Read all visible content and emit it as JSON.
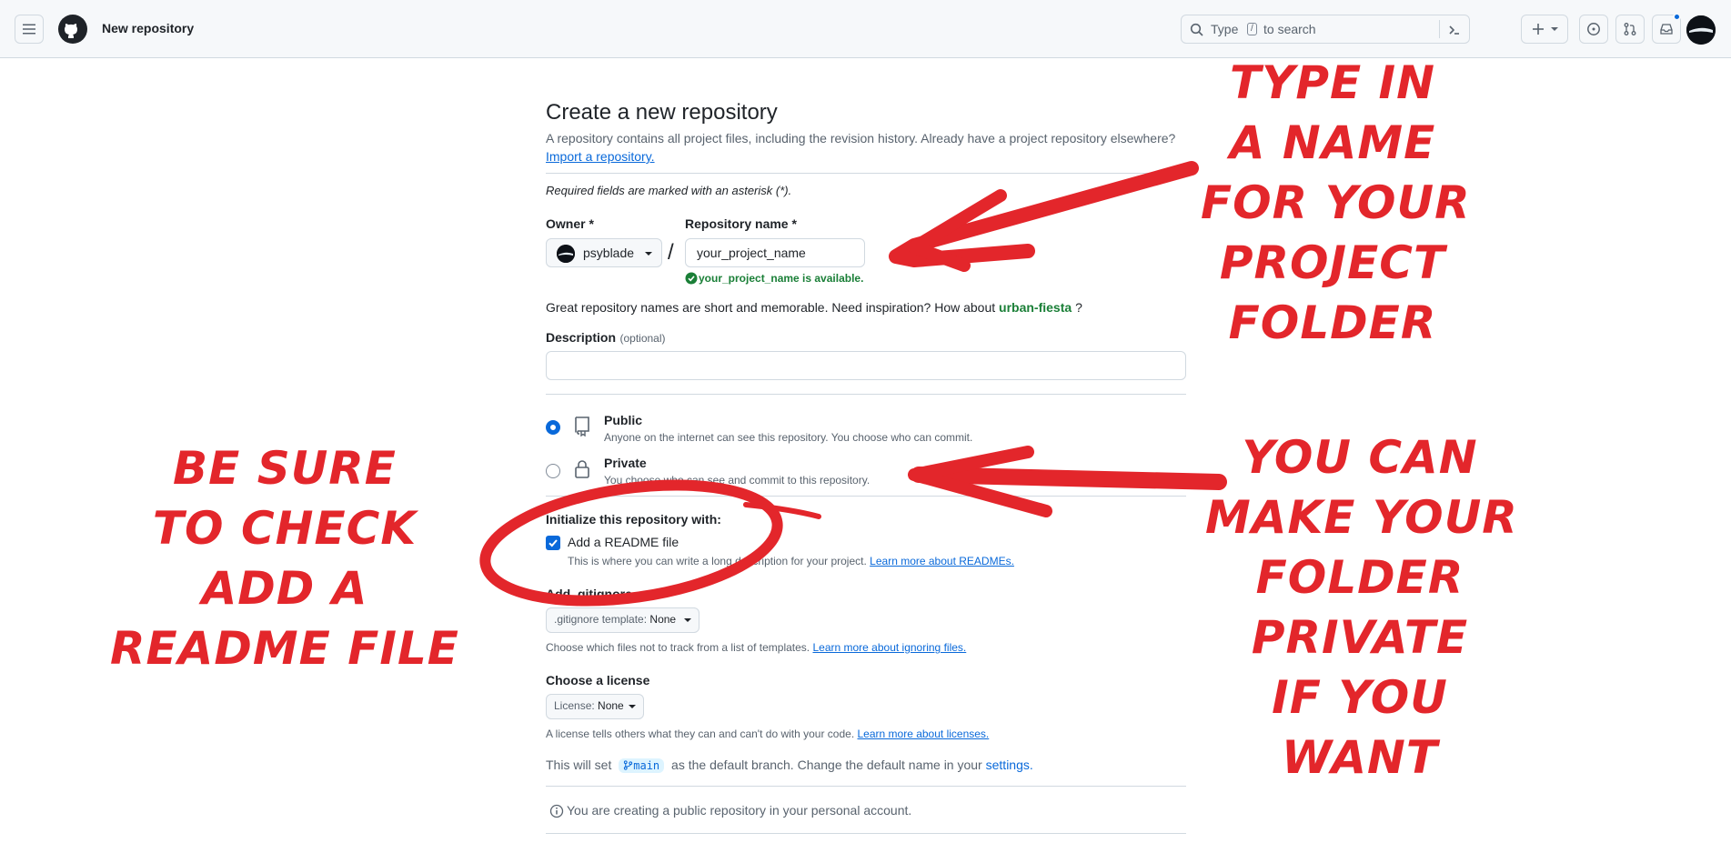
{
  "header": {
    "title": "New repository",
    "search": {
      "prefix": "Type",
      "key": "/",
      "suffix": "to search"
    }
  },
  "form": {
    "heading": "Create a new repository",
    "subtitle": "A repository contains all project files, including the revision history. Already have a project repository elsewhere?",
    "import_link": "Import a repository.",
    "required_note": "Required fields are marked with an asterisk (*).",
    "owner_label": "Owner *",
    "owner_value": "psyblade",
    "slash": "/",
    "repo_label": "Repository name *",
    "repo_value": "your_project_name",
    "availability": "your_project_name is available.",
    "inspiration_text": "Great repository names are short and memorable. Need inspiration? How about",
    "inspiration_name": "urban-fiesta",
    "inspiration_end": "?",
    "description_label": "Description",
    "description_optional": "(optional)",
    "description_value": "",
    "visibility": {
      "selected": "public",
      "public_title": "Public",
      "public_desc": "Anyone on the internet can see this repository. You choose who can commit.",
      "private_title": "Private",
      "private_desc": "You choose who can see and commit to this repository."
    },
    "init_label": "Initialize this repository with:",
    "readme_label": "Add a README file",
    "readme_checked": true,
    "readme_desc": "This is where you can write a long description for your project.",
    "readme_link": "Learn more about READMEs.",
    "gitignore_label": "Add .gitignore",
    "gitignore_select_prefix": ".gitignore template:",
    "gitignore_select_value": "None",
    "gitignore_desc": "Choose which files not to track from a list of templates.",
    "gitignore_link": "Learn more about ignoring files.",
    "license_label": "Choose a license",
    "license_select_prefix": "License:",
    "license_select_value": "None",
    "license_desc": "A license tells others what they can and can't do with your code.",
    "license_link": "Learn more about licenses.",
    "branch_pre": "This will set",
    "branch_name": "main",
    "branch_post": "as the default branch. Change the default name in your",
    "branch_link": "settings.",
    "info_note": "You are creating a public repository in your personal account."
  },
  "annotations": {
    "name": [
      "TYPE IN",
      "A NAME",
      "FOR YOUR",
      "PROJECT",
      "FOLDER"
    ],
    "readme": [
      "BE SURE",
      "TO CHECK",
      "ADD A",
      "README FILE"
    ],
    "private": [
      "YOU CAN",
      "MAKE YOUR",
      "FOLDER",
      "PRIVATE",
      "IF YOU",
      "WANT"
    ],
    "color": "#e3262b"
  },
  "colors": {
    "accent": "#0969da",
    "success": "#1a7f37",
    "header_bg": "#f6f8fa",
    "border": "#d1d9e0"
  }
}
